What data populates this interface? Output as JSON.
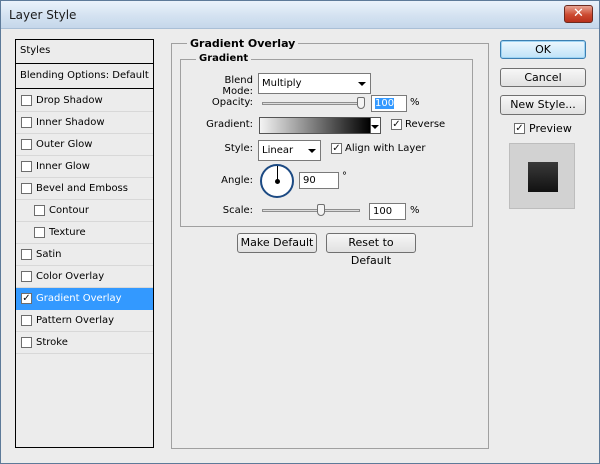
{
  "window": {
    "title": "Layer Style",
    "close_glyph": "✕"
  },
  "style_list": {
    "header": "Styles",
    "blending": "Blending Options: Default",
    "items": [
      {
        "label": "Drop Shadow",
        "checked": false
      },
      {
        "label": "Inner Shadow",
        "checked": false
      },
      {
        "label": "Outer Glow",
        "checked": false
      },
      {
        "label": "Inner Glow",
        "checked": false
      },
      {
        "label": "Bevel and Emboss",
        "checked": false
      },
      {
        "label": "Contour",
        "checked": false
      },
      {
        "label": "Texture",
        "checked": false
      },
      {
        "label": "Satin",
        "checked": false
      },
      {
        "label": "Color Overlay",
        "checked": false
      },
      {
        "label": "Gradient Overlay",
        "checked": true
      },
      {
        "label": "Pattern Overlay",
        "checked": false
      },
      {
        "label": "Stroke",
        "checked": false
      }
    ]
  },
  "panel": {
    "title": "Gradient Overlay",
    "group_title": "Gradient",
    "blend_mode_label": "Blend Mode:",
    "blend_mode_value": "Multiply",
    "opacity_label": "Opacity:",
    "opacity_value": "100",
    "opacity_unit": "%",
    "opacity_level": 1.0,
    "gradient_label": "Gradient:",
    "gradient_colors": [
      "#f4f4f4",
      "#000000"
    ],
    "reverse_label": "Reverse",
    "reverse_checked": true,
    "style_label": "Style:",
    "style_value": "Linear",
    "align_label": "Align with Layer",
    "align_checked": true,
    "angle_label": "Angle:",
    "angle_value": "90",
    "angle_unit": "°",
    "scale_label": "Scale:",
    "scale_value": "100",
    "scale_unit": "%",
    "scale_level": 0.6,
    "make_default": "Make Default",
    "reset_default": "Reset to Default"
  },
  "actions": {
    "ok": "OK",
    "cancel": "Cancel",
    "new_style": "New Style...",
    "preview_label": "Preview",
    "preview_checked": true
  },
  "colors": {
    "selection": "#3399ff",
    "title_close": "#cc4a31",
    "dial_border": "#1c4a83"
  },
  "icons": {
    "checkbox_checked": "✓",
    "dropdown": "chevron-down-icon",
    "close": "close-icon"
  }
}
